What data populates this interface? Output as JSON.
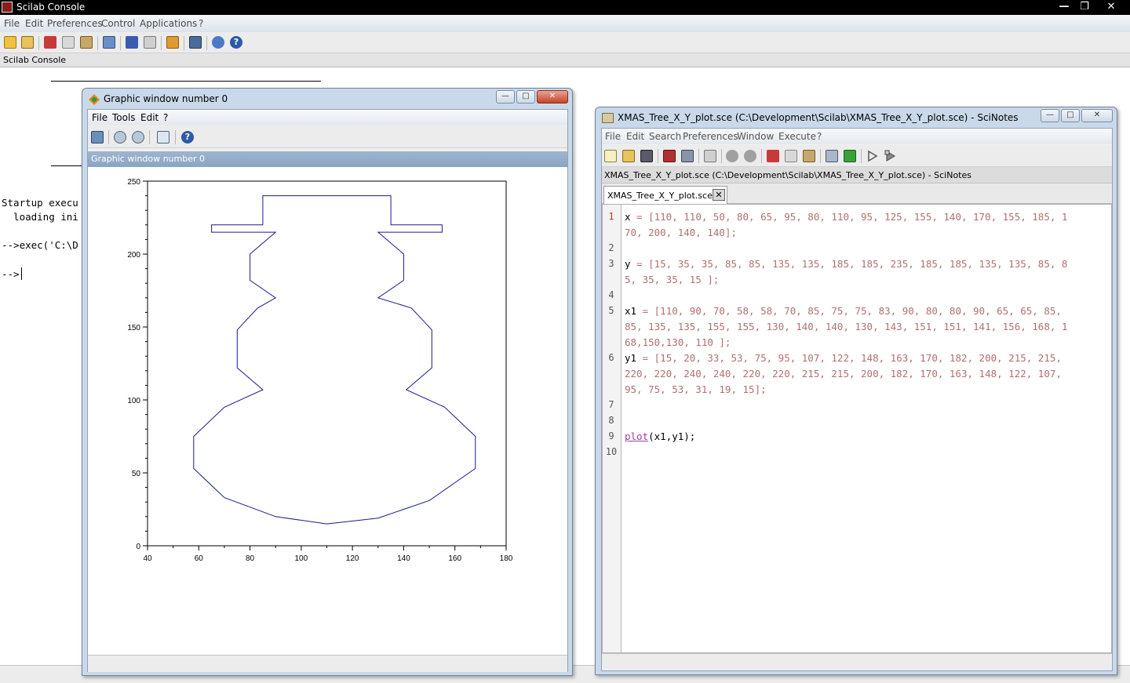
{
  "main_window": {
    "title": "Scilab Console",
    "controls": {
      "minimize": "—",
      "restore": "❐",
      "close": "✕"
    },
    "menu": [
      "File",
      "Edit",
      "Preferences",
      "Control",
      "Applications",
      "?"
    ],
    "toolbar_icons": [
      "new-script-icon",
      "open-file-icon",
      "cut-icon",
      "copy-icon",
      "paste-icon",
      "change-directory-icon",
      "font-icon",
      "print-icon",
      "variable-browser-icon",
      "scinotes-icon",
      "module-manager-icon",
      "help-icon"
    ],
    "console_tab_label": "Scilab Console",
    "console_lines": [
      "Startup execu",
      "  loading ini",
      "-->exec('C:\\D",
      "-->"
    ]
  },
  "graphic_window": {
    "title": "Graphic window number 0",
    "menu": [
      "File",
      "Tools",
      "Edit",
      "?"
    ],
    "toolbar_icons": [
      "rotate-icon",
      "zoom-in-icon",
      "zoom-out-icon",
      "new-window-icon",
      "help-icon"
    ],
    "header_label": "Graphic window number 0",
    "controls": {
      "minimize": "—",
      "restore": "□",
      "close": "✕"
    }
  },
  "chart_data": {
    "type": "line",
    "x": [
      110,
      90,
      70,
      58,
      58,
      70,
      85,
      75,
      75,
      83,
      90,
      80,
      80,
      90,
      65,
      65,
      85,
      85,
      135,
      135,
      155,
      155,
      130,
      140,
      140,
      130,
      143,
      151,
      151,
      141,
      156,
      168,
      168,
      150,
      130,
      110
    ],
    "y": [
      15,
      20,
      33,
      53,
      75,
      95,
      107,
      122,
      148,
      163,
      170,
      182,
      200,
      215,
      215,
      220,
      220,
      240,
      240,
      220,
      220,
      215,
      215,
      200,
      182,
      170,
      163,
      148,
      122,
      107,
      95,
      75,
      53,
      31,
      19,
      15
    ],
    "xlim": [
      40,
      180
    ],
    "ylim": [
      0,
      250
    ],
    "xticks": [
      "40",
      "60",
      "80",
      "100",
      "120",
      "140",
      "160",
      "180"
    ],
    "yticks": [
      "0",
      "50",
      "100",
      "150",
      "200",
      "250"
    ],
    "line_color": "#1a1a8c",
    "grid": false,
    "title": "",
    "xlabel": "",
    "ylabel": ""
  },
  "scinotes": {
    "title": "XMAS_Tree_X_Y_plot.sce (C:\\Development\\Scilab\\XMAS_Tree_X_Y_plot.sce) - SciNotes",
    "menu": [
      "File",
      "Edit",
      "Search",
      "Preferences",
      "Window",
      "Execute",
      "?"
    ],
    "toolbar_icons": [
      "new-icon",
      "open-icon",
      "open-recent-icon",
      "save-icon",
      "save-as-icon",
      "print-icon",
      "undo-icon",
      "redo-icon",
      "cut-icon",
      "copy-icon",
      "paste-icon",
      "find-icon",
      "load-into-scilab-icon",
      "execute-icon",
      "execute-with-echo-icon"
    ],
    "path_label": "XMAS_Tree_X_Y_plot.sce (C:\\Development\\Scilab\\XMAS_Tree_X_Y_plot.sce) - SciNotes",
    "tab_label": "XMAS_Tree_X_Y_plot.sce",
    "line_numbers": [
      "1",
      "2",
      "3",
      "4",
      "5",
      "6",
      "7",
      "8",
      "9",
      "10"
    ],
    "code": {
      "l1_var": "x",
      "l1a": " = [110, 110, 50, 80, 65, 95, 80, 110, 95, 125, 155, 140, 170, 155, 185, 1",
      "l1b": "70, 200, 140, 140];",
      "l3_var": "y",
      "l3a": " = [15, 35, 35, 85, 85, 135, 135, 185, 185, 235, 185, 185, 135, 135, 85, 8",
      "l3b": "5, 35, 35, 15 ];",
      "l5_var": "x1",
      "l5a": " = [110, 90, 70, 58, 58, 70, 85, 75, 75, 83, 90, 80, 80, 90, 65, 65, 85,",
      "l5b": "85, 135, 135, 155, 155, 130, 140, 140, 130, 143, 151, 151, 141, 156, 168, 1",
      "l5c": "68,150,130, 110 ];",
      "l6_var": "y1",
      "l6a": " = [15, 20, 33, 53, 75, 95, 107, 122, 148, 163, 170, 182, 200, 215, 215,",
      "l6b": "220, 220, 240, 240, 220, 220, 215, 215, 200, 182, 170, 163, 148, 122, 107,",
      "l6c": "95, 75, 53, 31, 19, 15];",
      "l9_fn": "plot",
      "l9_rest": "(x1,y1);"
    },
    "controls": {
      "minimize": "—",
      "restore": "□",
      "close": "✕"
    }
  }
}
